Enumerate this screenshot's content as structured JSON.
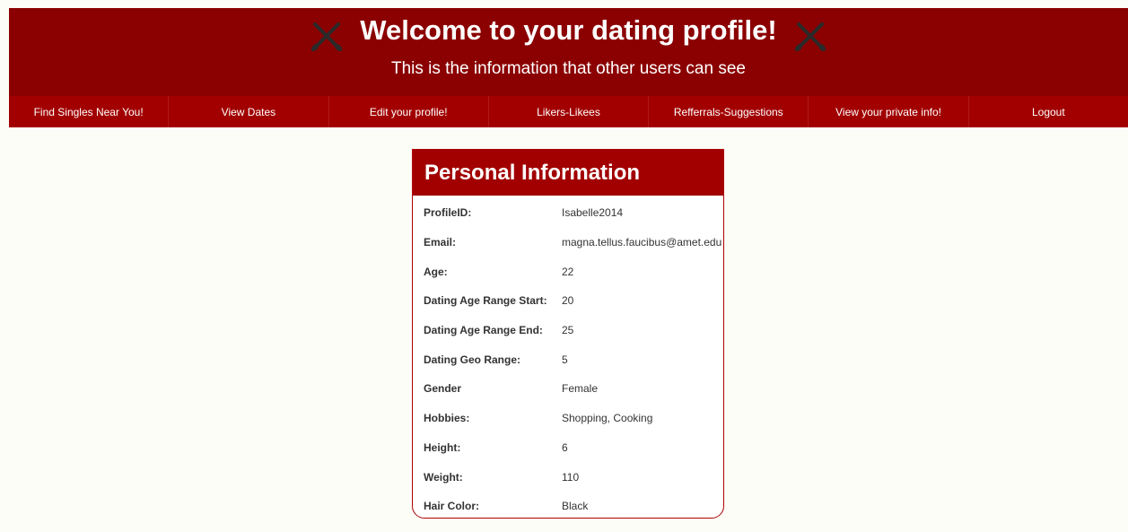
{
  "header": {
    "title": "Welcome to your dating profile!",
    "subtitle": "This is the information that other users can see",
    "background_color": "#8b0000",
    "left_icon": "crossed-oars-icon",
    "right_icon": "crossed-oars-icon"
  },
  "nav": {
    "items": [
      "Find Singles Near You!",
      "View Dates",
      "Edit your profile!",
      "Likers-Likees",
      "Refferrals-Suggestions",
      "View your private info!",
      "Logout"
    ],
    "background_color": "#a20000"
  },
  "card": {
    "title": "Personal Information",
    "rows": [
      {
        "label": "ProfileID:",
        "value": "Isabelle2014"
      },
      {
        "label": "Email:",
        "value": "magna.tellus.faucibus@amet.edu"
      },
      {
        "label": "Age:",
        "value": "22"
      },
      {
        "label": "Dating Age Range Start:",
        "value": "20"
      },
      {
        "label": "Dating Age Range End:",
        "value": "25"
      },
      {
        "label": "Dating Geo Range:",
        "value": "5"
      },
      {
        "label": "Gender",
        "value": "Female"
      },
      {
        "label": "Hobbies:",
        "value": "Shopping, Cooking"
      },
      {
        "label": "Height:",
        "value": "6"
      },
      {
        "label": "Weight:",
        "value": "110"
      },
      {
        "label": "Hair Color:",
        "value": "Black"
      }
    ]
  }
}
